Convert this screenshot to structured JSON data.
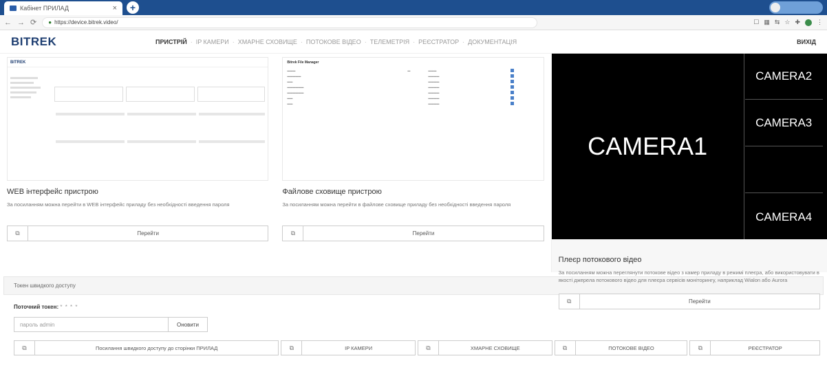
{
  "browser": {
    "tab_title": "Кабінет ПРИЛАД",
    "tab_close": "×",
    "new_tab": "+",
    "url": "https://device.bitrek.video/"
  },
  "header": {
    "logo": "BITREK",
    "nav": [
      "ПРИСТРІЙ",
      "IP КАМЕРИ",
      "ХМАРНЕ СХОВИЩЕ",
      "ПОТОКОВЕ ВІДЕО",
      "ТЕЛЕМЕТРІЯ",
      "РЕЄСТРАТОР",
      "ДОКУМЕНТАЦІЯ"
    ],
    "nav_sep": "·",
    "exit": "ВИХІД"
  },
  "panels": [
    {
      "title": "WEB інтерфейс пристрою",
      "desc": "За посиланням можна перейти в WEB інтерфейс приладу без необхідності введення пароля",
      "button": "Перейти"
    },
    {
      "title": "Файлове сховище пристрою",
      "desc": "За посиланням можна перейти в файлове сховище приладу без необхідності введення пароля",
      "button": "Перейти"
    },
    {
      "title": "Плеєр потокового відео",
      "desc": "За посиланням можна переглянути потокове відео з камер приладу в режимі плеєра, або використовувати в якості джерела потокового відео для плеєра сервісів моніторингу, наприклад Wialon або Aurora",
      "button": "Перейти"
    }
  ],
  "cameras": {
    "main": "CAMERA1",
    "side": [
      "CAMERA2",
      "CAMERA3",
      "CAMERA4"
    ]
  },
  "thumb_file": {
    "title": "Bitrek File Manager"
  },
  "tokens": {
    "header": "Токен швидкого доступу",
    "current_label": "Поточний токен:",
    "current_value": "* * * *",
    "input_placeholder": "пароль admin",
    "refresh": "Оновити",
    "quick": [
      "Посилання швидкого доступу до сторінки ПРИЛАД",
      "IP КАМЕРИ",
      "ХМАРНЕ СХОВИЩЕ",
      "ПОТОКОВЕ ВІДЕО",
      "РЕЄСТРАТОР"
    ]
  },
  "icons": {
    "copy": "copy-icon",
    "lock": "lock-icon"
  },
  "colors": {
    "chrome": "#1e4f8f",
    "logo": "#1f3f72"
  }
}
